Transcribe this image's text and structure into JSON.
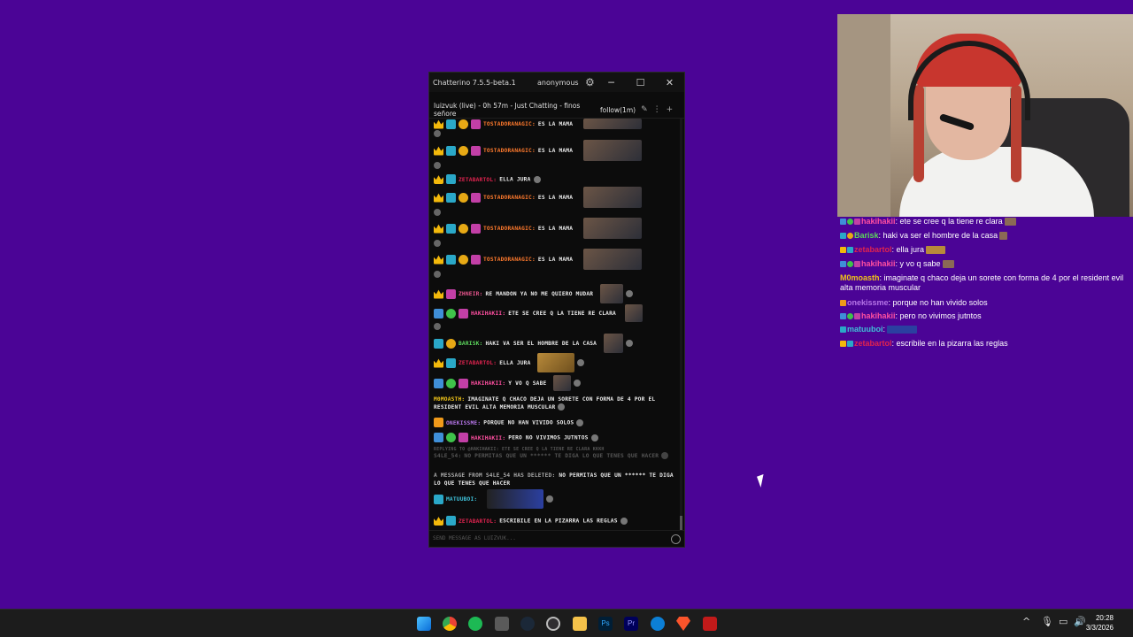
{
  "chatterino": {
    "title": "Chatterino 7.5.5-beta.1",
    "account": "anonymous",
    "min": "─",
    "max": "☐",
    "close": "✕",
    "tab_title": "luizvuk (live) - 0h 57m - Just Chatting - finos señore",
    "follow": "follow(1m)",
    "input_placeholder": "SEND MESSAGE AS LUIZVUK...",
    "messages": [
      {
        "user": "TOSTADORANAGIC:",
        "text": "ES LA MAMA",
        "user_color": "#ff7a2d"
      },
      {
        "user": "TOSTADORANAGIC:",
        "text": "ES LA MAMA",
        "user_color": "#ff7a2d"
      },
      {
        "user": "ZETABARTOL:",
        "text": "ELLA JURA",
        "user_color": "#e0234f"
      },
      {
        "user": "TOSTADORANAGIC:",
        "text": "ES LA MAMA",
        "user_color": "#ff7a2d"
      },
      {
        "user": "TOSTADORANAGIC:",
        "text": "ES LA MAMA",
        "user_color": "#ff7a2d"
      },
      {
        "user": "TOSTADORANAGIC:",
        "text": "ES LA MAMA",
        "user_color": "#ff7a2d"
      },
      {
        "user": "ZHNEIR:",
        "text": "RE MANDON YA NO ME QUIERO MUDAR",
        "user_color": "#e8558d"
      },
      {
        "user": "HAKIHAKII:",
        "text": "ETE SE CREE Q LA TIENE RE CLARA",
        "user_color": "#ff4fa0"
      },
      {
        "user": "BARISK:",
        "text": "HAKI VA SER EL HOMBRE DE LA CASA",
        "user_color": "#5cd65c"
      },
      {
        "user": "ZETABARTOL:",
        "text": "ELLA JURA",
        "user_color": "#e0234f"
      },
      {
        "user": "HAKIHAKII:",
        "text": "Y VO Q SABE",
        "user_color": "#ff4fa0"
      },
      {
        "user": "M0MOASTH:",
        "text": "IMAGINATE Q CHACO DEJA UN SORETE CON FORMA DE 4 POR EL RESIDENT EVIL ALTA MEMORIA MUSCULAR",
        "user_color": "#f0c419"
      },
      {
        "user": "ONEKISSME:",
        "text": "PORQUE NO HAN VIVIDO SOLOS",
        "user_color": "#b675e8"
      },
      {
        "user": "HAKIHAKII:",
        "text": "PERO NO VIVIMOS JUTNTOS",
        "user_color": "#ff4fa0"
      },
      {
        "user": "REPLYING TO @HAKIHAKII: ETE SE CREE Q LA TIENE RE CLARA KKKH",
        "text": ""
      },
      {
        "user": "S4LE_54:",
        "text": "NO PERMITAS QUE UN ****** TE DIGA LO QUE TENES QUE HACER",
        "user_color": "#666"
      },
      {
        "user": "A MESSAGE FROM S4LE_54 HAS DELETED:",
        "text": "NO PERMITAS QUE UN ****** TE DIGA LO QUE TENES QUE HACER"
      },
      {
        "user": "MATUUBOI:",
        "text": "",
        "user_color": "#3fc0d8"
      },
      {
        "user": "ZETABARTOL:",
        "text": "ESCRIBILE EN LA PIZARRA LAS REGLAS",
        "user_color": "#e0234f"
      }
    ]
  },
  "overlay_chat": [
    {
      "user": "hakihakii",
      "text": ": ete se cree q la tiene re clara",
      "color": "#ff4fa0"
    },
    {
      "user": "Barisk",
      "text": ": haki va ser el hombre de la casa",
      "color": "#5cd65c"
    },
    {
      "user": "zetabartol",
      "text": ": ella jura",
      "color": "#e0234f"
    },
    {
      "user": "hakihakii",
      "text": ": y vo q sabe",
      "color": "#ff4fa0"
    },
    {
      "user": "M0moasth",
      "text": ": imaginate q chaco deja un sorete con forma de 4 por el resident evil alta memoria muscular",
      "color": "#f0c419"
    },
    {
      "user": "onekissme",
      "text": ": porque no han vivido solos",
      "color": "#b675e8"
    },
    {
      "user": "hakihakii",
      "text": ": pero no vivimos jutntos",
      "color": "#ff4fa0"
    },
    {
      "user": "matuuboi",
      "text": ":",
      "color": "#3fc0d8"
    },
    {
      "user": "zetabartol",
      "text": ": escribile en la pizarra las reglas",
      "color": "#e0234f"
    }
  ],
  "clock": {
    "time": "20:28",
    "date": "3/3/2026"
  },
  "icons": [
    "windows-start-icon",
    "chrome-icon",
    "spotify-icon",
    "steam-icon",
    "obs-icon",
    "folder-icon",
    "photoshop-icon",
    "premiere-icon",
    "ccleaner-icon",
    "brave-icon",
    "app-icon"
  ],
  "colors": {
    "background": "#4b0496",
    "taskbar": "#1c1c1c",
    "chat_bg": "#0c0c0c"
  }
}
